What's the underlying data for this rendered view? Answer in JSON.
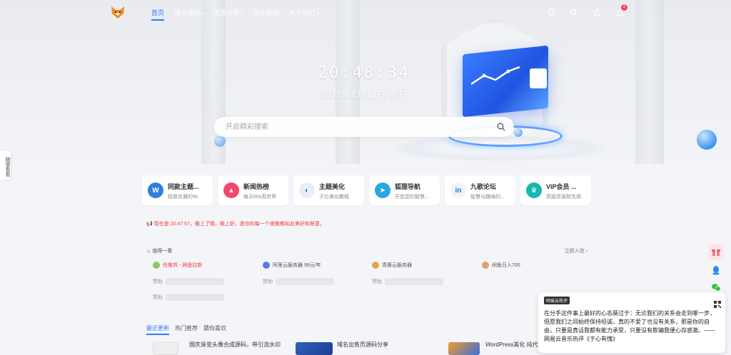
{
  "nav": {
    "menu": [
      {
        "label": "首页",
        "caret": false,
        "active": true
      },
      {
        "label": "建站笔记",
        "caret": true,
        "active": false
      },
      {
        "label": "资源分享",
        "caret": true,
        "active": false
      },
      {
        "label": "技术教程",
        "caret": false,
        "active": false
      },
      {
        "label": "关于我们",
        "caret": true,
        "active": false
      }
    ],
    "notification_count": "2"
  },
  "side_tab": "随便看看",
  "hero": {
    "time": "20:48:34",
    "date": "2025年1月12日 周日",
    "search_placeholder": "开启精彩搜索"
  },
  "cards": [
    {
      "title": "同款主题...",
      "sub": "极致优雅的W...",
      "icon": "wordpress-icon",
      "color": "#2f7fdf"
    },
    {
      "title": "新闻热榜",
      "sub": "每天60s观世界",
      "icon": "fire-icon",
      "color": "#f4476b"
    },
    {
      "title": "主题美化",
      "sub": "子比美化教程",
      "icon": "zibll-icon",
      "color": "#e8edf7"
    },
    {
      "title": "狐狸导航",
      "sub": "开启您的智慧...",
      "icon": "paper-plane-icon",
      "color": "#29a7e0"
    },
    {
      "title": "九歌论坛",
      "sub": "智慧与趣味的...",
      "icon": "linkedin-icon",
      "color": "#f0f3f7"
    },
    {
      "title": "VIP会员 ...",
      "sub": "高级资源抢先用",
      "icon": "vip-crown-icon",
      "color": "#16b8b0"
    }
  ],
  "notice": "现在是 20:47:57，晚上了哦，晚上好，愿你的每一个夜晚都如此美好和惬意。",
  "recommend": {
    "title": "值得一看",
    "more": "立即入驻 ›",
    "items": [
      {
        "label": "任推邦 - 网盘拉新",
        "color": "#8cc46a",
        "red": true
      },
      {
        "label": "阿里云服务器 99元/年",
        "color": "#5c7ce6",
        "red": false
      },
      {
        "label": "青藤云服务器",
        "color": "#e8a24a",
        "red": false
      },
      {
        "label": "闲鱼日入700",
        "color": "#e0a070",
        "red": false
      }
    ],
    "placeholder": "赞助"
  },
  "tabs": [
    {
      "label": "最近更新",
      "active": true
    },
    {
      "label": "热门推荐",
      "active": false
    },
    {
      "label": "猜你喜欢",
      "active": false
    }
  ],
  "posts": [
    "国庆渐变头像合成源码，带引流水印",
    "域名出售页源码分享",
    "WordPress美化 纯代码美化网站底部"
  ],
  "music": {
    "tag": "网易云热评",
    "text": "在分手这件事上最好的心态莫过于：无论我们的关系会走到哪一步，但愿我们之间始终保持坦诚，真的不爱了也没有关系，那是你的自由，只要是真话我都有能力承受，只要没有欺骗我便心存感激。—— 网易云音乐热评《于心有愧》"
  }
}
